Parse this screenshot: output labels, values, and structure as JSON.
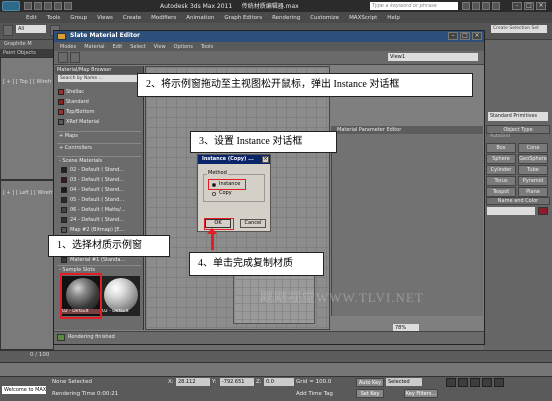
{
  "app": {
    "title": "Autodesk 3ds Max  2011",
    "file_title": "传统材质编辑器.max",
    "help_search_placeholder": "Type a keyword or phrase",
    "menu": [
      "Edit",
      "Tools",
      "Group",
      "Views",
      "Create",
      "Modifiers",
      "Animation",
      "Graph Editors",
      "Rendering",
      "Customize",
      "MAXScript",
      "Help"
    ]
  },
  "toolbar": {
    "selection_filter": "All",
    "named_selection_set": "Create Selection Set"
  },
  "ribbon": {
    "graphite_label": "Graphite M",
    "poly_label": "Paint Objects"
  },
  "viewports": {
    "top_label": "[ + ] [ Top ] [ Wirefr",
    "left_label": "[ + ] [ Left ] [ Wirefr"
  },
  "command_panel": {
    "primitives": "Standard Primitives",
    "object_type_header": "Object Type",
    "autogrid": "AutoGrid",
    "object_types": [
      "Box",
      "Cone",
      "Sphere",
      "GeoSphere",
      "Cylinder",
      "Tube",
      "Torus",
      "Pyramid",
      "Teapot",
      "Plane"
    ],
    "name_color_header": "Name and Color",
    "color": "#8b1a2a"
  },
  "sme": {
    "title": "Slate Material Editor",
    "menu": [
      "Modes",
      "Material",
      "Edit",
      "Select",
      "View",
      "Options",
      "Tools"
    ],
    "view_dropdown": "View1",
    "browser_header": "Material/Map Browser",
    "search_placeholder": "Search by Name ...",
    "library": [
      {
        "name": "Shellac",
        "color": "#a03030"
      },
      {
        "name": "Standard",
        "color": "#8a2020"
      },
      {
        "name": "Top/Bottom",
        "color": "#993333"
      },
      {
        "name": "XRef Material",
        "color": "#5a5a5a"
      }
    ],
    "maps_group": "+ Maps",
    "controllers_group": "+ Controllers",
    "scene_group": "- Scene Materials",
    "scene_materials": [
      {
        "name": "02 - Default ( Stand...",
        "color": "#222222"
      },
      {
        "name": "03 - Default ( Stand...",
        "color": "#3a1a1a"
      },
      {
        "name": "04 - Default ( Stand...",
        "color": "#1a1a1a"
      },
      {
        "name": "05 - Default ( Stand...",
        "color": "#2a2a2a"
      },
      {
        "name": "06 - Default ( Matte/...",
        "color": "#444444"
      },
      {
        "name": "24 - Default ( Stand...",
        "color": "#333333"
      },
      {
        "name": "Map #2 (Bitmap) [E...",
        "color": "#555555"
      },
      {
        "name": "Material #1 (Standa...",
        "color": "#3a3a3a"
      }
    ],
    "sample_slots_header": "- Sample Slots",
    "slot1_label": "02 - Default",
    "slot2_label": "02 - Default",
    "param_editor_header": "Material Parameter Editor",
    "zoom": "78%",
    "status": "Rendering finished"
  },
  "instance_dialog": {
    "title": "Instance (Copy) ...",
    "close": "×",
    "method_label": "Method",
    "options": [
      "Instance",
      "Copy"
    ],
    "selected": "Instance",
    "ok": "OK",
    "cancel": "Cancel"
  },
  "callouts": {
    "step1": "1、选择材质示例窗",
    "step2": "2、将示例窗拖动至主视图松开鼠标，弹出 Instance 对话框",
    "step3": "3、设置 Instance 对话框",
    "step4": "4、单击完成复制材质"
  },
  "watermark": "飕飕视觉WWW.TLVI.NET",
  "timeline": {
    "frame": "0 / 100"
  },
  "status": {
    "welcome": "Welcome to MAX",
    "selection": "None Selected",
    "render_time": "Rendering Time  0:00:21",
    "x": "28.112",
    "y": "-792.651",
    "z": "0.0",
    "grid": "Grid = 100.0",
    "add_time_tag": "Add Time Tag",
    "auto_key": "Auto Key",
    "set_key": "Set Key",
    "selected_dd": "Selected",
    "key_filters": "Key Filters..."
  },
  "colors": {
    "highlight": "#e51c23",
    "title_bar": "#2e4f7a",
    "dialog_title": "#0a246a"
  }
}
